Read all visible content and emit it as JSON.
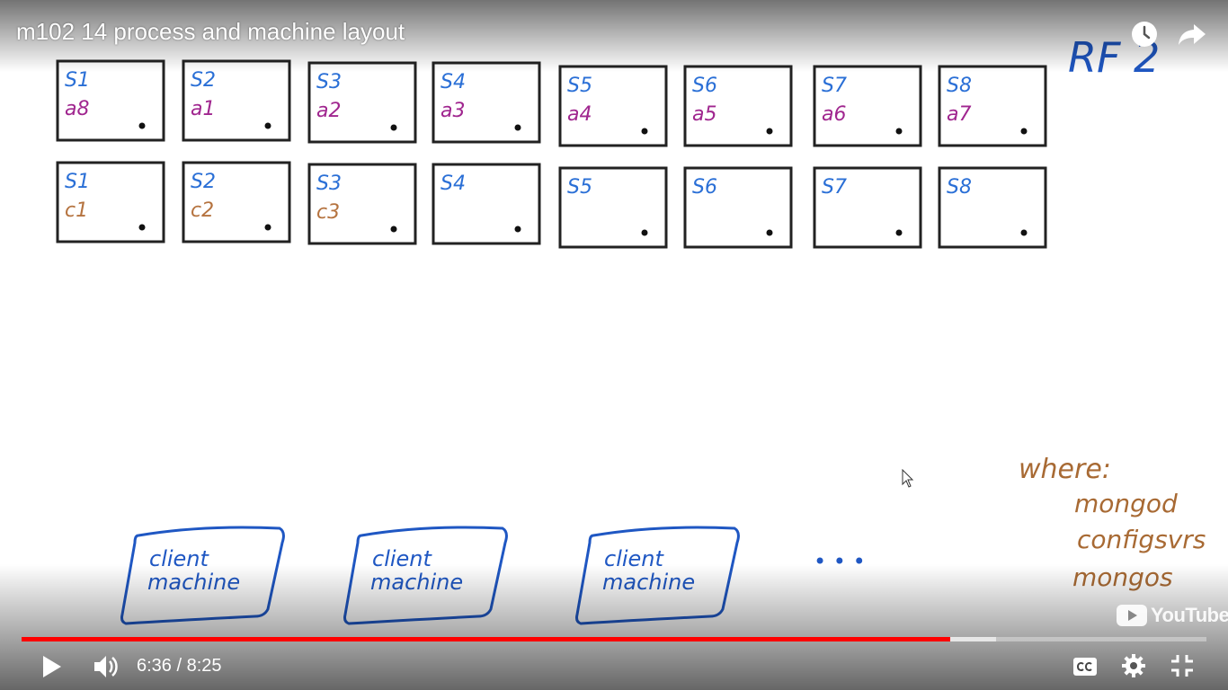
{
  "player": {
    "title": "m102 14 process and machine layout",
    "time_current": "6:36",
    "time_separator": " / ",
    "time_total": "8:25",
    "played_fraction": 0.7836,
    "buffered_fraction": 0.8225,
    "brand": "YouTube",
    "icons": {
      "watch_later": "clock-icon",
      "share": "share-icon",
      "play": "play-icon",
      "volume": "volume-icon",
      "captions": "cc-icon",
      "settings": "gear-icon",
      "exit_fullscreen": "exit-fullscreen-icon"
    },
    "colors": {
      "progress": "#ff0000",
      "controls": "#ffffff"
    }
  },
  "whiteboard": {
    "corner_note": "RF 2",
    "server_rows": [
      [
        {
          "shard": "S1",
          "member": "a8"
        },
        {
          "shard": "S2",
          "member": "a1"
        },
        {
          "shard": "S3",
          "member": "a2"
        },
        {
          "shard": "S4",
          "member": "a3"
        },
        {
          "shard": "S5",
          "member": "a4"
        },
        {
          "shard": "S6",
          "member": "a5"
        },
        {
          "shard": "S7",
          "member": "a6"
        },
        {
          "shard": "S8",
          "member": "a7"
        }
      ],
      [
        {
          "shard": "S1",
          "member": "c1"
        },
        {
          "shard": "S2",
          "member": "c2"
        },
        {
          "shard": "S3",
          "member": "c3"
        },
        {
          "shard": "S4",
          "member": ""
        },
        {
          "shard": "S5",
          "member": ""
        },
        {
          "shard": "S6",
          "member": ""
        },
        {
          "shard": "S7",
          "member": ""
        },
        {
          "shard": "S8",
          "member": ""
        }
      ]
    ],
    "clients": [
      {
        "line1": "client",
        "line2": "machine"
      },
      {
        "line1": "client",
        "line2": "machine"
      },
      {
        "line1": "client",
        "line2": "machine"
      }
    ],
    "ellipsis": "• • •",
    "where_heading": "where:",
    "where_items": [
      "mongod",
      "configsvrs",
      "mongos"
    ],
    "colors": {
      "shard_label": "#2a6fd6",
      "member_a": "#a0268f",
      "member_c": "#b5733f",
      "client": "#1f57c3",
      "notes": "#a86a34",
      "box": "#222222"
    }
  }
}
